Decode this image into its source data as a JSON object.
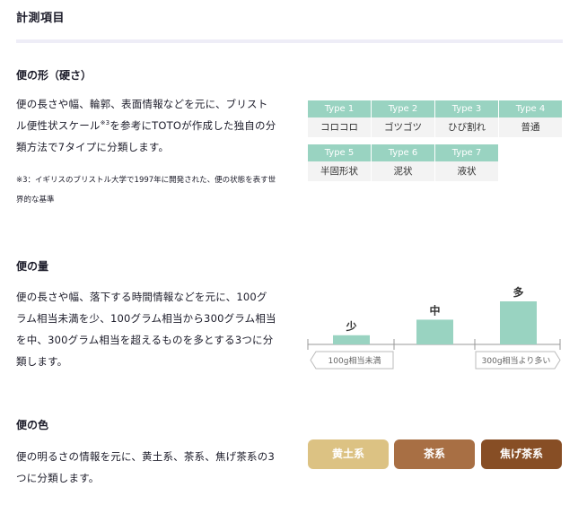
{
  "page": {
    "title": "計測項目"
  },
  "shape": {
    "title": "便の形（硬さ）",
    "desc_part1": "便の長さや幅、輪郭、表面情報などを元に、ブリストル便性状スケール",
    "desc_sup": "※3",
    "desc_part2": "を参考にTOTOが作成した独自の分類方法で7タイプに分類します。",
    "note": "※3：イギリスのブリストル大学で1997年に開発された、便の状態を表す世界的な基準",
    "types": [
      {
        "label": "Type 1",
        "value": "コロコロ"
      },
      {
        "label": "Type 2",
        "value": "ゴツゴツ"
      },
      {
        "label": "Type 3",
        "value": "ひび割れ"
      },
      {
        "label": "Type 4",
        "value": "普通"
      },
      {
        "label": "Type 5",
        "value": "半固形状"
      },
      {
        "label": "Type 6",
        "value": "泥状"
      },
      {
        "label": "Type 7",
        "value": "液状"
      }
    ]
  },
  "amount": {
    "title": "便の量",
    "desc": "便の長さや幅、落下する時間情報などを元に、100グラム相当未満を少、100グラム相当から300グラム相当を中、300グラム相当を超えるものを多とする3つに分類します。",
    "chart_data": {
      "type": "bar",
      "categories": [
        "少",
        "中",
        "多"
      ],
      "values": [
        1,
        2.7,
        4.7
      ],
      "left_label": "100g相当未満",
      "right_label": "300g相当より多い",
      "color": "#99d3c1"
    }
  },
  "color": {
    "title": "便の色",
    "desc": "便の明るさの情報を元に、黄土系、茶系、焦げ茶系の3つに分類します。",
    "items": [
      {
        "label": "黄土系",
        "color": "#dcc283"
      },
      {
        "label": "茶系",
        "color": "#a86f44"
      },
      {
        "label": "焦げ茶系",
        "color": "#874e25"
      }
    ]
  }
}
